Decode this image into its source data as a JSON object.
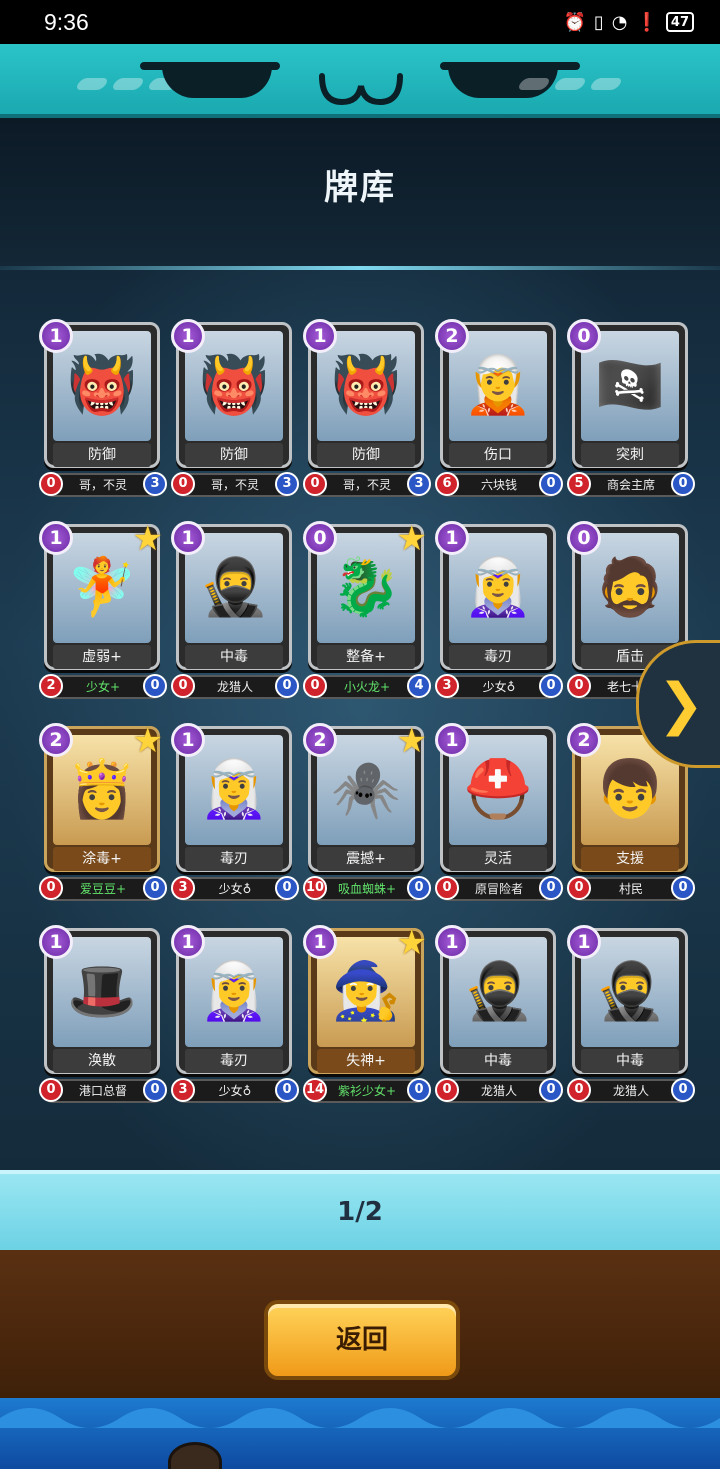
{
  "status_bar": {
    "time": "9:36",
    "battery": "47"
  },
  "header": {
    "title": "牌库"
  },
  "pager": {
    "text": "1/2"
  },
  "buttons": {
    "back": "返回"
  },
  "cards": [
    {
      "cost": "1",
      "name": "防御",
      "owner": "哥，不灵",
      "left": "0",
      "right": "3",
      "star": false,
      "gold": false,
      "green": false,
      "portrait": "👹"
    },
    {
      "cost": "1",
      "name": "防御",
      "owner": "哥，不灵",
      "left": "0",
      "right": "3",
      "star": false,
      "gold": false,
      "green": false,
      "portrait": "👹"
    },
    {
      "cost": "1",
      "name": "防御",
      "owner": "哥，不灵",
      "left": "0",
      "right": "3",
      "star": false,
      "gold": false,
      "green": false,
      "portrait": "👹"
    },
    {
      "cost": "2",
      "name": "伤口",
      "owner": "六块钱",
      "left": "6",
      "right": "0",
      "star": false,
      "gold": false,
      "green": false,
      "portrait": "🧝"
    },
    {
      "cost": "0",
      "name": "突刺",
      "owner": "商会主席",
      "left": "5",
      "right": "0",
      "star": false,
      "gold": false,
      "green": false,
      "portrait": "🏴‍☠️"
    },
    {
      "cost": "1",
      "name": "虚弱+",
      "owner": "少女+",
      "left": "2",
      "right": "0",
      "star": true,
      "gold": false,
      "green": true,
      "portrait": "🧚"
    },
    {
      "cost": "1",
      "name": "中毒",
      "owner": "龙猎人",
      "left": "0",
      "right": "0",
      "star": false,
      "gold": false,
      "green": false,
      "portrait": "🥷"
    },
    {
      "cost": "0",
      "name": "整备+",
      "owner": "小火龙+",
      "left": "0",
      "right": "4",
      "star": true,
      "gold": false,
      "green": true,
      "portrait": "🐉"
    },
    {
      "cost": "1",
      "name": "毒刃",
      "owner": "少女♁",
      "left": "3",
      "right": "0",
      "star": false,
      "gold": false,
      "green": false,
      "portrait": "🧝‍♀️"
    },
    {
      "cost": "0",
      "name": "盾击",
      "owner": "老七十三",
      "left": "0",
      "right": "0",
      "star": false,
      "gold": false,
      "green": false,
      "portrait": "🧔"
    },
    {
      "cost": "2",
      "name": "涂毒+",
      "owner": "爱豆豆+",
      "left": "0",
      "right": "0",
      "star": true,
      "gold": true,
      "green": true,
      "portrait": "👸"
    },
    {
      "cost": "1",
      "name": "毒刃",
      "owner": "少女♁",
      "left": "3",
      "right": "0",
      "star": false,
      "gold": false,
      "green": false,
      "portrait": "🧝‍♀️"
    },
    {
      "cost": "2",
      "name": "震撼+",
      "owner": "吸血蜘蛛+",
      "left": "10",
      "right": "0",
      "star": true,
      "gold": false,
      "green": true,
      "portrait": "🕷️"
    },
    {
      "cost": "1",
      "name": "灵活",
      "owner": "原冒险者",
      "left": "0",
      "right": "0",
      "star": false,
      "gold": false,
      "green": false,
      "portrait": "⛑️"
    },
    {
      "cost": "2",
      "name": "支援",
      "owner": "村民",
      "left": "0",
      "right": "0",
      "star": false,
      "gold": true,
      "green": false,
      "portrait": "👦"
    },
    {
      "cost": "1",
      "name": "涣散",
      "owner": "港口总督",
      "left": "0",
      "right": "0",
      "star": false,
      "gold": false,
      "green": false,
      "portrait": "🎩"
    },
    {
      "cost": "1",
      "name": "毒刃",
      "owner": "少女♁",
      "left": "3",
      "right": "0",
      "star": false,
      "gold": false,
      "green": false,
      "portrait": "🧝‍♀️"
    },
    {
      "cost": "1",
      "name": "失神+",
      "owner": "紫衫少女+",
      "left": "14",
      "right": "0",
      "star": true,
      "gold": true,
      "green": true,
      "portrait": "🧙‍♀️"
    },
    {
      "cost": "1",
      "name": "中毒",
      "owner": "龙猎人",
      "left": "0",
      "right": "0",
      "star": false,
      "gold": false,
      "green": false,
      "portrait": "🥷"
    },
    {
      "cost": "1",
      "name": "中毒",
      "owner": "龙猎人",
      "left": "0",
      "right": "0",
      "star": false,
      "gold": false,
      "green": false,
      "portrait": "🥷"
    }
  ],
  "icons": {
    "next_arrow": "chevron-right-icon",
    "star": "star-icon"
  }
}
